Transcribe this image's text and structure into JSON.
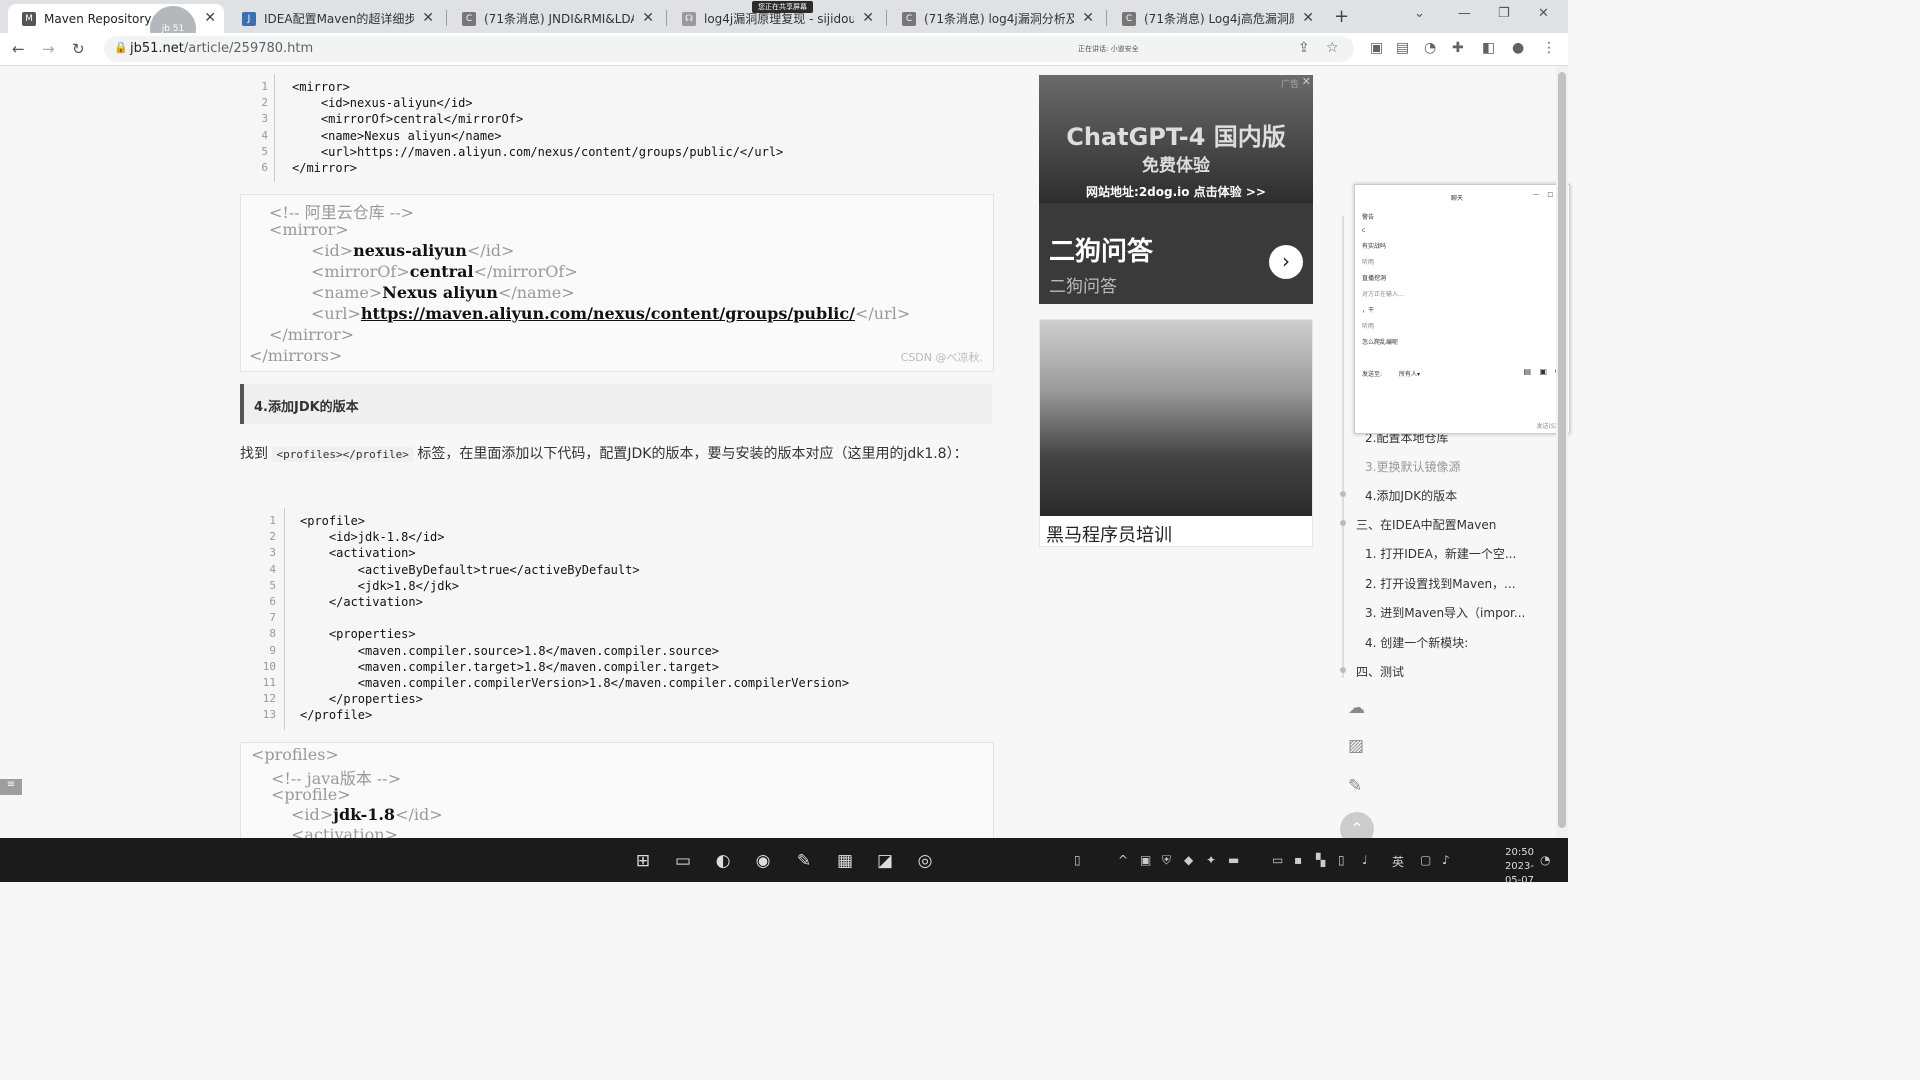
{
  "browser": {
    "tabs": [
      {
        "title": "Maven Repository: o",
        "icon": "maven-icon"
      },
      {
        "title": "IDEA配置Maven的超详细步骤",
        "icon": "jb51-icon"
      },
      {
        "title": "(71条消息) JNDI&RMI&LDAP",
        "icon": "csdn-icon"
      },
      {
        "title": "log4j漏洞原理复现 - sijidou - 博",
        "icon": "cnblogs-icon"
      },
      {
        "title": "(71条消息) log4j漏洞分析及总结",
        "icon": "csdn-icon"
      },
      {
        "title": "(71条消息) Log4j高危漏洞原理",
        "icon": "csdn-icon"
      }
    ],
    "new_tab": "+",
    "url_host": "jb51.net",
    "url_path": "/article/259780.htm",
    "avatar_text": "jb 51",
    "sharing_label": "您正在共享屏幕",
    "reading_label": "正在讲话: 小道安全"
  },
  "article": {
    "code1": {
      "numbers": [
        "1",
        "2",
        "3",
        "4",
        "5",
        "6"
      ],
      "lines": [
        "<mirror>",
        "    <id>nexus-aliyun</id>",
        "    <mirrorOf>central</mirrorOf>",
        "    <name>Nexus aliyun</name>",
        "    <url>https://maven.aliyun.com/nexus/content/groups/public/</url>",
        "</mirror>"
      ]
    },
    "shot1": {
      "comment": "<!-- 阿里云仓库 -->",
      "open_mirror": "<mirror>",
      "id_open": "<id>",
      "id_val": "nexus-aliyun",
      "id_close": "</id>",
      "mof_open": "<mirrorOf>",
      "mof_val": "central",
      "mof_close": "</mirrorOf>",
      "name_open": "<name>",
      "name_val": "Nexus aliyun",
      "name_close": "</name>",
      "url_open": "<url>",
      "url_val": "https://maven.aliyun.com/nexus/content/groups/public/",
      "url_close": "</url>",
      "close_mirror": "</mirror>",
      "close_mirrors": "</mirrors>",
      "watermark": "CSDN @べ凉秋."
    },
    "heading": "4.添加JDK的版本",
    "para_before": "找到 ",
    "para_code": "<profiles></profile>",
    "para_after": " 标签，在里面添加以下代码，配置JDK的版本，要与安装的版本对应（这里用的jdk1.8）：",
    "code2": {
      "numbers": [
        "1",
        "2",
        "3",
        "4",
        "5",
        "6",
        "7",
        "8",
        "9",
        "10",
        "11",
        "12",
        "13"
      ],
      "lines": [
        "<profile>",
        "    <id>jdk-1.8</id>",
        "    <activation>",
        "        <activeByDefault>true</activeByDefault>",
        "        <jdk>1.8</jdk>",
        "    </activation>",
        "",
        "    <properties>",
        "        <maven.compiler.source>1.8</maven.compiler.source>",
        "        <maven.compiler.target>1.8</maven.compiler.target>",
        "        <maven.compiler.compilerVersion>1.8</maven.compiler.compilerVersion>",
        "    </properties>",
        "</profile>"
      ]
    },
    "shot2": {
      "profiles": "<profiles>",
      "comment": "<!-- java版本 -->",
      "profile": "<profile>",
      "id_open": "<id>",
      "id_val": "jdk-1.8",
      "id_close": "</id>",
      "activation": "<activation>"
    }
  },
  "ads": {
    "ad1": {
      "headline": "ChatGPT-4 国内版",
      "subhead": "免费体验",
      "site": "网站地址:2dog.io 点击体验 >>",
      "brand": "二狗问答",
      "brand_sub": "二狗问答",
      "tag": "广告"
    },
    "ad2": {
      "caption": "黑马程序员培训"
    }
  },
  "toc": {
    "items": [
      {
        "label": "2.配置本地仓库"
      },
      {
        "label": "3.更换默认镜像源"
      },
      {
        "label": "4.添加JDK的版本"
      },
      {
        "label": "三、在IDEA中配置Maven"
      },
      {
        "label": "1. 打开IDEA，新建一个空..."
      },
      {
        "label": "2. 打开设置找到Maven，..."
      },
      {
        "label": "3. 进到Maven导入（impor..."
      },
      {
        "label": "4. 创建一个新模块:"
      },
      {
        "label": "四、测试"
      }
    ]
  },
  "chat": {
    "title": "聊天",
    "messages": [
      "警告",
      "c",
      "有实战吗",
      "听雨",
      "直播挖洞",
      "对方正在输入...",
      "，干",
      "听雨",
      "怎么爬乱编呢"
    ],
    "send_to_label": "发送至:",
    "send_to_value": "所有人",
    "send_button": "发送(S)"
  },
  "taskbar": {
    "ime": "英",
    "time": "20:50",
    "date": "2023-05-07"
  },
  "colors": {
    "accent": "#1a73e8",
    "tab_active": "#ffffff",
    "taskbar": "#1b1b1b"
  }
}
